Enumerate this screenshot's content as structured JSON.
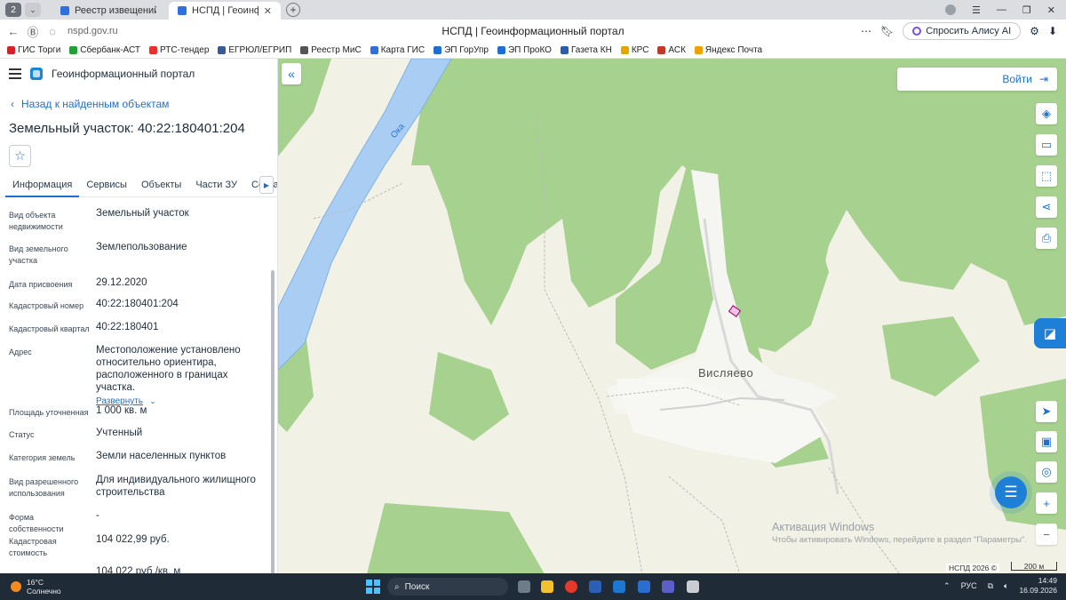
{
  "browser": {
    "tab_counter": "2",
    "tabs": [
      {
        "title": "Реестр извещений",
        "active": false
      },
      {
        "title": "НСПД | Геоинформаци",
        "active": true
      }
    ],
    "url": "nspd.gov.ru",
    "page_title": "НСПД | Геоинформационный портал",
    "alice_label": "Спросить Алису AI",
    "bookmarks": [
      {
        "label": "ГИС Торги",
        "color": "#d2232a"
      },
      {
        "label": "Сбербанк-АСТ",
        "color": "#21a038"
      },
      {
        "label": "РТС-тендер",
        "color": "#e5322d"
      },
      {
        "label": "ЕГРЮЛ/ЕГРИП",
        "color": "#3b5998"
      },
      {
        "label": "Реестр МиС",
        "color": "#555555"
      },
      {
        "label": "Карта ГИС",
        "color": "#2f6fde"
      },
      {
        "label": "ЭП ГорУпр",
        "color": "#1e6fd0"
      },
      {
        "label": "ЭП ПроКО",
        "color": "#1e6fd0"
      },
      {
        "label": "Газета КН",
        "color": "#2a5ca8"
      },
      {
        "label": "КРС",
        "color": "#e0a800"
      },
      {
        "label": "АСК",
        "color": "#c0392b"
      },
      {
        "label": "Яндекс Почта",
        "color": "#f0a000"
      }
    ]
  },
  "panel": {
    "app_title": "Геоинформационный портал",
    "back_label": "Назад к найденным объектам",
    "parcel_title": "Земельный участок: 40:22:180401:204",
    "tabs": [
      "Информация",
      "Сервисы",
      "Объекты",
      "Части ЗУ",
      "Состав"
    ],
    "properties": [
      {
        "label": "Вид объекта недвижимости",
        "value": "Земельный участок"
      },
      {
        "label": "Вид земельного участка",
        "value": "Землепользование"
      },
      {
        "label": "Дата присвоения",
        "value": "29.12.2020"
      },
      {
        "label": "Кадастровый номер",
        "value": "40:22:180401:204"
      },
      {
        "label": "Кадастровый квартал",
        "value": "40:22:180401"
      },
      {
        "label": "Адрес",
        "value": "Местоположение установлено относительно ориентира, расположенного в границах участка."
      },
      {
        "label": "Площадь уточненная",
        "value": "1 000 кв. м"
      },
      {
        "label": "Статус",
        "value": "Учтенный"
      },
      {
        "label": "Категория земель",
        "value": "Земли населенных пунктов"
      },
      {
        "label": "Вид разрешенного использования",
        "value": "Для индивидуального жилищного строительства"
      },
      {
        "label": "Форма собственности",
        "value": "-"
      },
      {
        "label": "Кадастровая стоимость",
        "value": "104 022,99 руб."
      },
      {
        "label": "",
        "value": "104 022 руб./кв. м"
      }
    ],
    "expand_label": "Развернуть"
  },
  "map": {
    "login_label": "Войти",
    "village_label": "Висляево",
    "river_label": "Ока",
    "watermark_title": "Активация Windows",
    "watermark_text": "Чтобы активировать Windows, перейдите в раздел \"Параметры\".",
    "copyright": "НСПД 2026 ©",
    "scale_label": "200 м"
  },
  "taskbar": {
    "temperature": "16°C",
    "weather": "Солнечно",
    "search_placeholder": "Поиск",
    "language": "РУС",
    "time": "14:49",
    "date": "16.09.2026"
  }
}
